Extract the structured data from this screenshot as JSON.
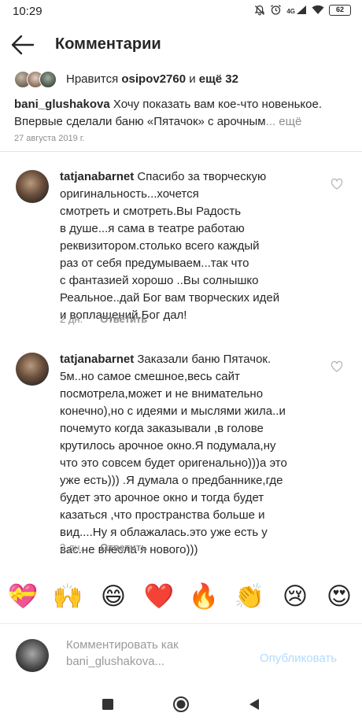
{
  "status": {
    "time": "10:29",
    "network": "4G",
    "battery": "62"
  },
  "header": {
    "title": "Комментарии",
    "back_icon": "arrow-left-icon"
  },
  "likes": {
    "prefix": "Нравится ",
    "user": "osipov2760",
    "middle": " и ",
    "others": "ещё 32"
  },
  "caption": {
    "user": "bani_glushakova",
    "text_line1": " Хочу показать вам кое-что новенькое.",
    "text_line2": "Впервые сделали баню «Пятачок» с арочным",
    "more_ellipsis": "...",
    "more": " ещё",
    "date": "27 августа 2019 г."
  },
  "comments": [
    {
      "user": "tatjanabarnet",
      "lines": [
        " Спасибо за творческую",
        "оригинальность...хочется",
        "смотреть и смотреть.Вы Радость",
        "в душе...я сама в театре работаю",
        "реквизитором.столько всего каждый",
        "раз от себя предумываем...так что",
        "с фантазией хорошо ..Вы солнышко",
        "Реальное..дай Бог вам творческих идей",
        "и воплащений.Бог дал!"
      ],
      "time": "2 дн.",
      "reply": "Ответить"
    },
    {
      "user": "tatjanabarnet",
      "lines": [
        " Заказали баню Пятачок.",
        "5м..но самое смешное,весь сайт",
        "посмотрела,может и не внимательно",
        "конечно),но с идеями и мыслями жила..и",
        "почемуто когда заказывали ,в голове",
        "крутилось арочное окно.Я подумала,ну",
        "что это совсем будет оригенально)))а это",
        "уже есть))) .Я думала о предбаннике,где",
        "будет это арочное окно и тогда будет",
        "казаться ,что пространства больше и",
        "вид....Ну я облажалась.это уже есть у",
        "вас.не внесла я нового)))"
      ],
      "time": "2 дн.",
      "reply": "Ответить"
    }
  ],
  "emoji_bar": [
    "💝",
    "🙌",
    "😄",
    "❤️",
    "🔥",
    "👏",
    "😢",
    "😍"
  ],
  "composer": {
    "placeholder_line1": "Комментировать как",
    "placeholder_line2": "bani_glushakova...",
    "publish": "Опубликовать"
  },
  "colors": {
    "text": "#262626",
    "muted": "#8e8e8e",
    "publish_disabled": "#b3dbff",
    "heart_outline": "#b5b5b5"
  }
}
